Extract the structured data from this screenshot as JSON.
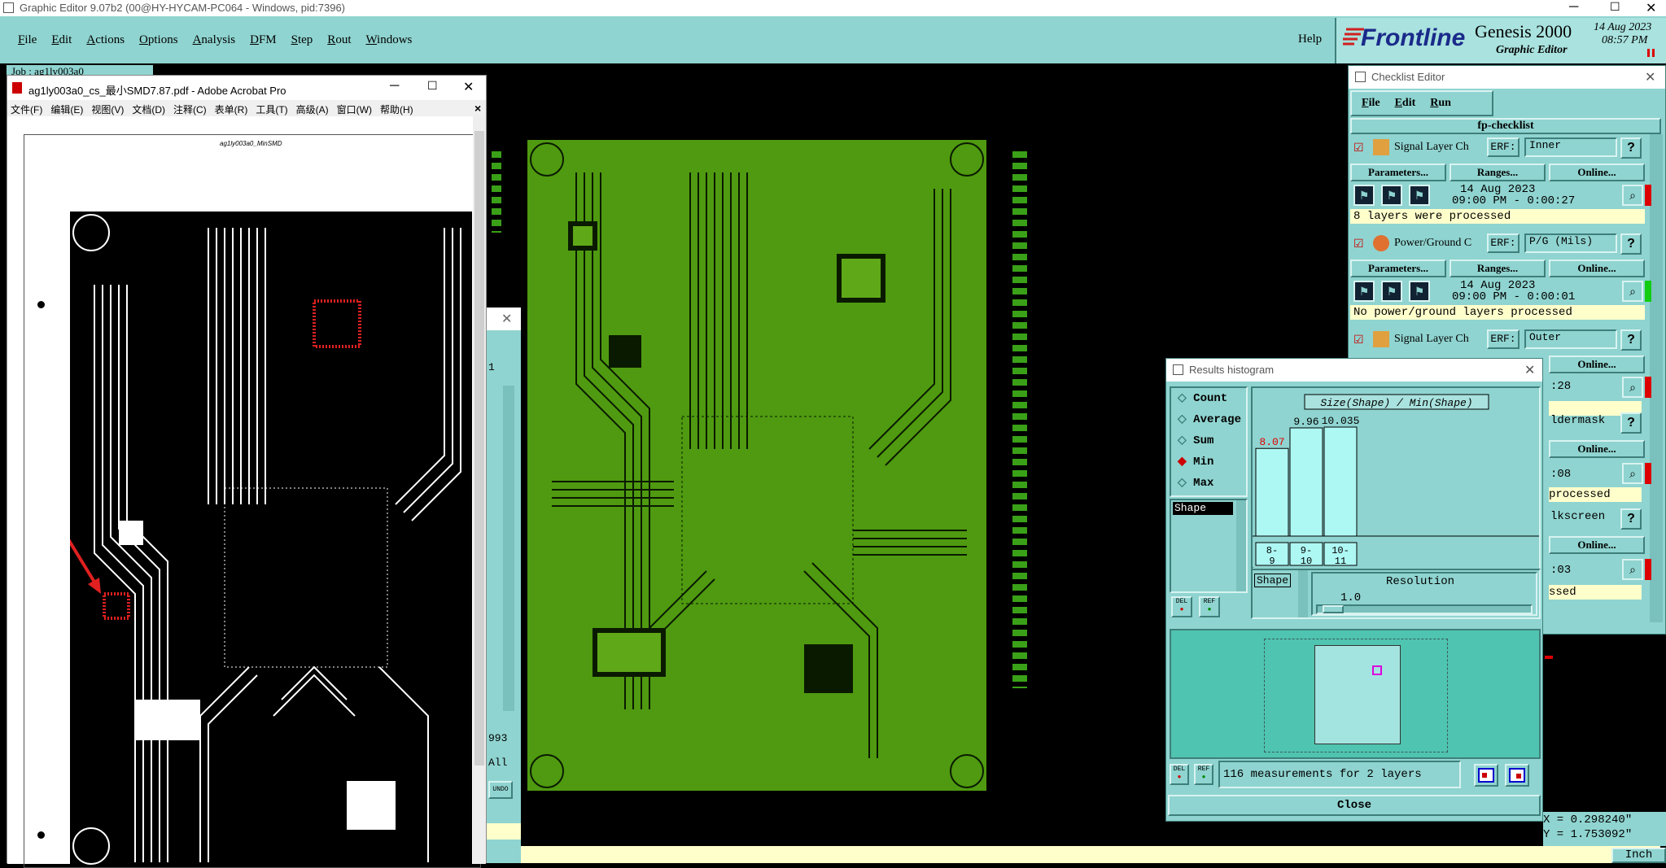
{
  "main_window": {
    "title": "Graphic Editor 9.07b2 (00@HY-HYCAM-PC064 - Windows, pid:7396)",
    "menu": [
      "File",
      "Edit",
      "Actions",
      "Options",
      "Analysis",
      "DFM",
      "Step",
      "Rout",
      "Windows"
    ],
    "help": "Help",
    "brand": "Frontline",
    "product": "Genesis 2000",
    "product_sub": "Graphic Editor",
    "date": "14 Aug 2023",
    "time": "08:57 PM",
    "job_label": "Job : ag1ly003a0",
    "coord_x": "X = 0.298240\"",
    "coord_y": "Y = 1.753092\"",
    "units": "Inch"
  },
  "acrobat": {
    "title": "ag1ly003a0_cs_最小SMD7.87.pdf - Adobe Acrobat Pro",
    "menu": [
      "文件(F)",
      "编辑(E)",
      "视图(V)",
      "文档(D)",
      "注释(C)",
      "表单(R)",
      "工具(T)",
      "高级(A)",
      "窗口(W)",
      "帮助(H)"
    ],
    "page_header": "ag1ly003a0_MinSMD",
    "close": "×"
  },
  "partial_window": {
    "value1": "1",
    "value2": "993",
    "value3": "All",
    "undo": "UNDO"
  },
  "checklist": {
    "title": "Checklist Editor",
    "menu": [
      "File",
      "Edit",
      "Run"
    ],
    "name": "fp-checklist",
    "erf": "ERF:",
    "buttons": {
      "params": "Parameters...",
      "ranges": "Ranges...",
      "online": "Online..."
    },
    "items": [
      {
        "name": "Signal Layer Ch",
        "erf": "Inner",
        "date": "14 Aug 2023",
        "time": "09:00 PM - 0:00:27",
        "status": "8 layers were processed",
        "state": "red"
      },
      {
        "name": "Power/Ground C",
        "erf": "P/G (Mils)",
        "date": "14 Aug 2023",
        "time": "09:00 PM - 0:00:01",
        "status": "No power/ground layers processed",
        "state": "green"
      },
      {
        "name": "Signal Layer Ch",
        "erf": "Outer",
        "time_tail": ":28",
        "state": "red"
      }
    ],
    "extra": [
      {
        "erf": "ldermask",
        "time_tail": ":08",
        "status": "processed"
      },
      {
        "erf": "lkscreen",
        "time_tail": ":03",
        "status": "ssed"
      }
    ]
  },
  "histogram": {
    "title": "Results histogram",
    "options": [
      "Count",
      "Average",
      "Sum",
      "Min",
      "Max"
    ],
    "selected": "Min",
    "list_item": "Shape",
    "resolution_label": "Resolution",
    "resolution_value": "1.0",
    "shape_tag": "Shape",
    "summary": "116 measurements for 2 layers",
    "close": "Close",
    "del": "DEL",
    "ref": "REF"
  },
  "chart_data": {
    "type": "bar",
    "title": "Size(Shape) / Min(Shape)",
    "categories": [
      "8-9",
      "9-10",
      "10-11"
    ],
    "category_labels": [
      [
        "8-",
        "9"
      ],
      [
        "9-",
        "10"
      ],
      [
        "10-",
        "11"
      ]
    ],
    "values": [
      8.07,
      9.96,
      10.035
    ],
    "value_labels": [
      "8.07",
      "9.96",
      "10.035"
    ],
    "ylim": [
      0,
      10.035
    ],
    "highlight_color": "#e00000"
  }
}
